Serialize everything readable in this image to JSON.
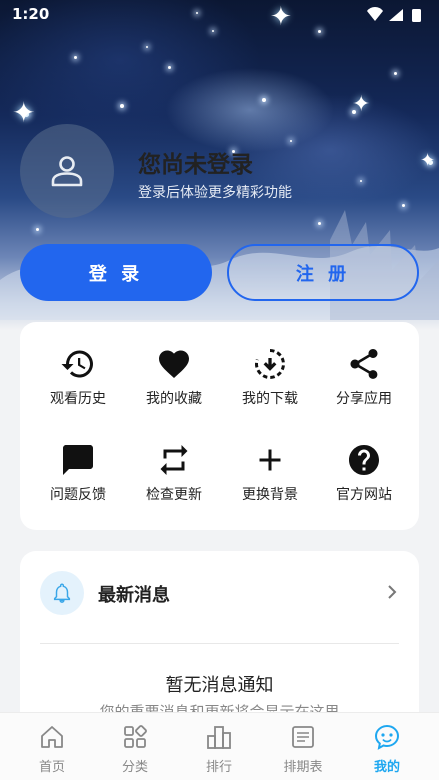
{
  "status_bar": {
    "time": "1:20"
  },
  "profile": {
    "title": "您尚未登录",
    "subtitle": "登录后体验更多精彩功能",
    "icon": "user-icon"
  },
  "auth": {
    "login_label": "登 录",
    "register_label": "注 册",
    "accent": "#2266ee"
  },
  "features": [
    {
      "label": "观看历史",
      "icon": "history-icon"
    },
    {
      "label": "我的收藏",
      "icon": "heart-icon"
    },
    {
      "label": "我的下载",
      "icon": "download-icon"
    },
    {
      "label": "分享应用",
      "icon": "share-icon"
    },
    {
      "label": "问题反馈",
      "icon": "feedback-icon"
    },
    {
      "label": "检查更新",
      "icon": "repeat-icon"
    },
    {
      "label": "更换背景",
      "icon": "plus-icon"
    },
    {
      "label": "官方网站",
      "icon": "help-icon"
    }
  ],
  "messages": {
    "title": "最新消息",
    "empty_title": "暂无消息通知",
    "empty_subtitle": "您的重要消息和更新将会显示在这里",
    "icon": "bell-icon"
  },
  "tabs": [
    {
      "label": "首页",
      "icon": "home-icon"
    },
    {
      "label": "分类",
      "icon": "category-icon"
    },
    {
      "label": "排行",
      "icon": "ranking-icon"
    },
    {
      "label": "排期表",
      "icon": "schedule-icon"
    },
    {
      "label": "我的",
      "icon": "profile-icon",
      "active": true
    }
  ],
  "colors": {
    "tab_active": "#1ea7f0",
    "bell_bg": "#e4f2fc"
  }
}
